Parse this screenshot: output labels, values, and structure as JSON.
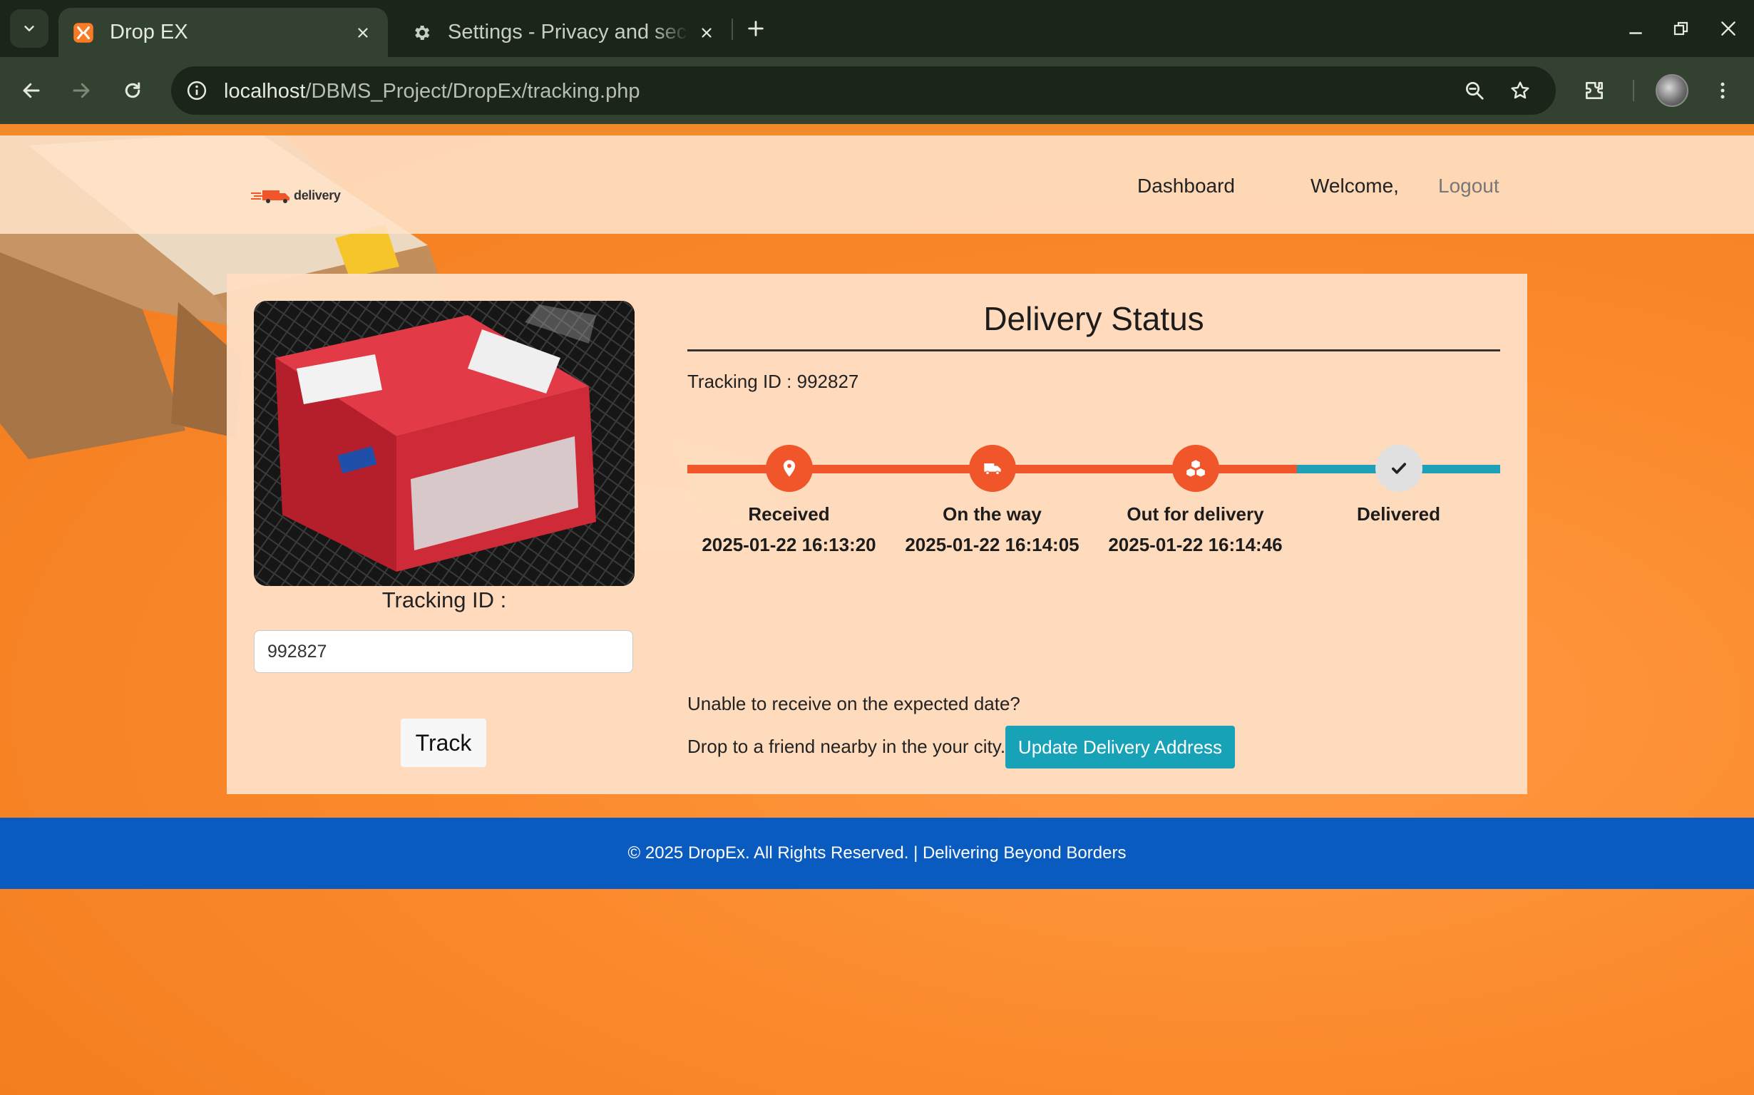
{
  "browser": {
    "tabs": [
      {
        "title": "Drop EX",
        "active": true,
        "icon": "xampp-icon"
      },
      {
        "title": "Settings - Privacy and security",
        "active": false,
        "icon": "gear-icon"
      }
    ],
    "url": {
      "host": "localhost",
      "path": "/DBMS_Project/DropEx/tracking.php"
    }
  },
  "site": {
    "logo_text": "delivery",
    "nav": {
      "dashboard": "Dashboard",
      "welcome": "Welcome,",
      "logout": "Logout"
    },
    "colors": {
      "accent": "#f0562a",
      "info": "#17a2b8",
      "footer": "#0a5bbf",
      "pending_track": "#1ea0b7"
    }
  },
  "tracking_form": {
    "label": "Tracking ID :",
    "value": "992827",
    "button": "Track"
  },
  "status": {
    "title": "Delivery Status",
    "tracking_id_line": "Tracking ID : 992827",
    "steps": [
      {
        "label": "Received",
        "date": "2025-01-22 16:13:20",
        "done": true,
        "icon": "map-pin-icon"
      },
      {
        "label": "On the way",
        "date": "2025-01-22 16:14:05",
        "done": true,
        "icon": "truck-icon"
      },
      {
        "label": "Out for delivery",
        "date": "2025-01-22 16:14:46",
        "done": true,
        "icon": "boxes-icon"
      },
      {
        "label": "Delivered",
        "date": "",
        "done": false,
        "icon": "check-icon"
      }
    ],
    "unable_text": "Unable to receive on the expected date?",
    "drop_text": "Drop to a friend nearby in the your city.",
    "update_button": "Update Delivery Address"
  },
  "footer": {
    "text": "© 2025 DropEx. All Rights Reserved. | Delivering Beyond Borders"
  }
}
